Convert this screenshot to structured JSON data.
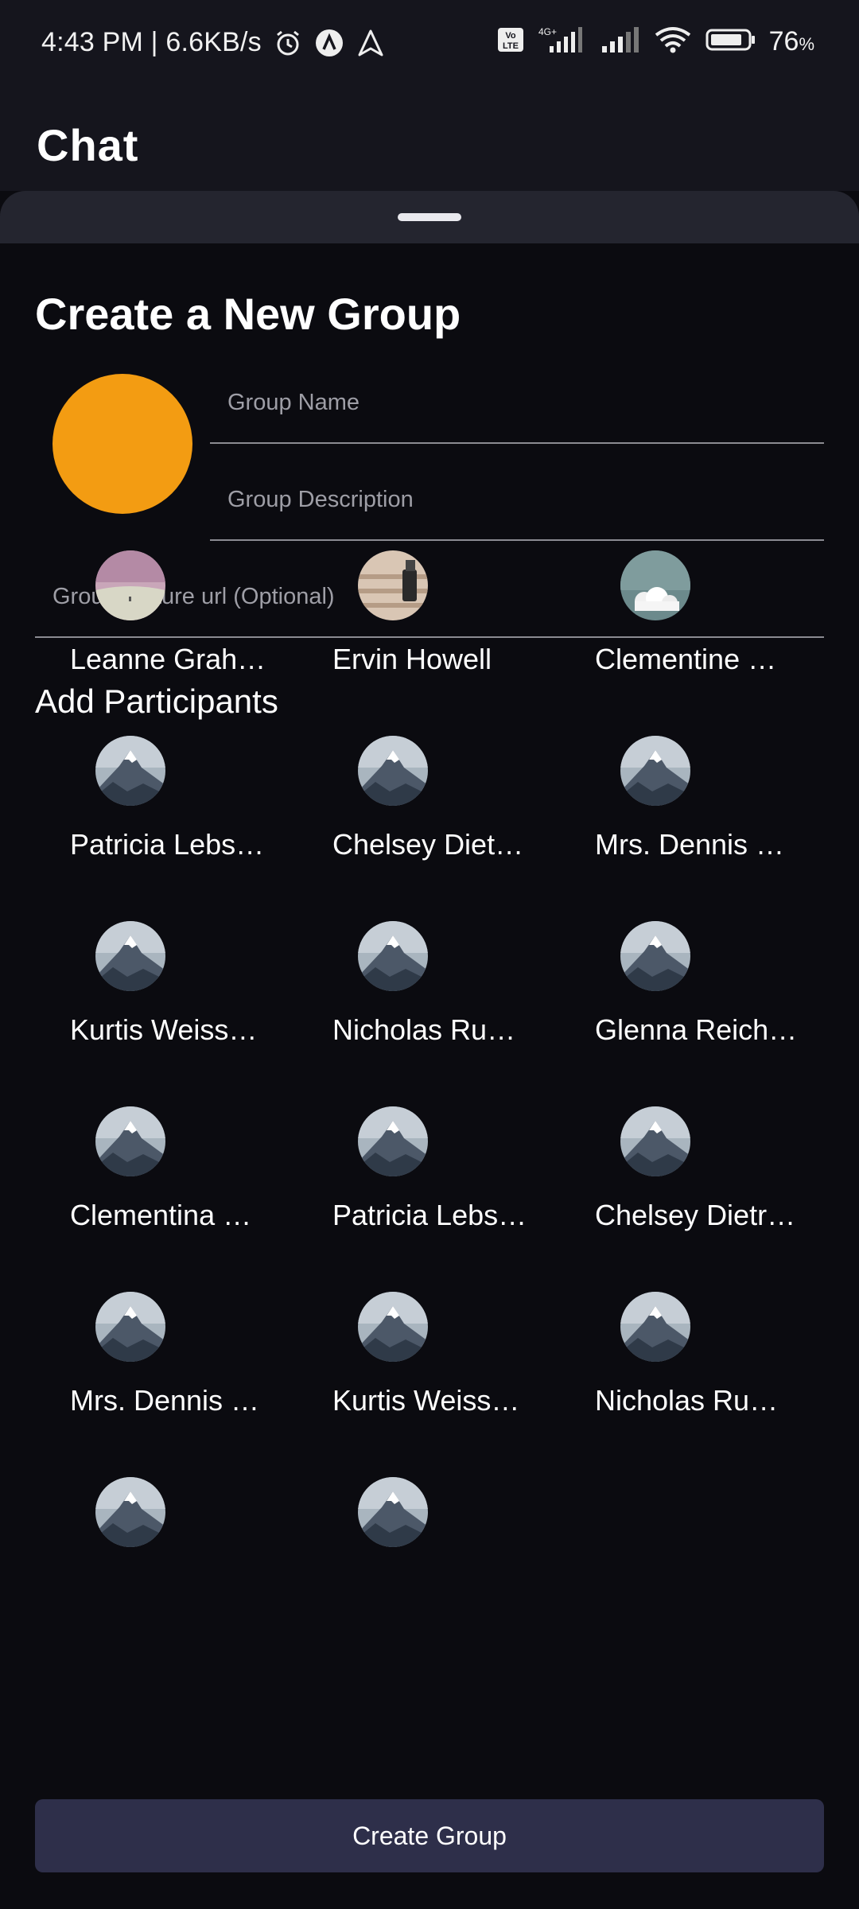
{
  "status_bar": {
    "time_speed": "4:43 PM | 6.6KB/s",
    "battery_percent": "76",
    "battery_unit": "%",
    "network": "4G+",
    "icons": [
      "alarm-icon",
      "app-a-icon",
      "navigation-icon",
      "volte-icon",
      "signal-icon",
      "signal-icon",
      "wifi-icon",
      "battery-icon"
    ]
  },
  "header": {
    "title": "Chat"
  },
  "sheet": {
    "title": "Create a New Group",
    "group_avatar_color": "#f39c12",
    "fields": {
      "name_placeholder": "Group Name",
      "description_placeholder": "Group Description",
      "picture_url_placeholder": "Group Picture url (Optional)"
    },
    "participants_title": "Add Participants",
    "participants": [
      {
        "name": "Leanne Grah…",
        "avatar": "pink-landscape"
      },
      {
        "name": "Ervin Howell",
        "avatar": "wood-interior"
      },
      {
        "name": "Clementine …",
        "avatar": "clouds-sky"
      },
      {
        "name": "Patricia Lebs…",
        "avatar": "mountain"
      },
      {
        "name": "Chelsey Diet…",
        "avatar": "mountain"
      },
      {
        "name": "Mrs. Dennis …",
        "avatar": "mountain"
      },
      {
        "name": "Kurtis Weiss…",
        "avatar": "mountain"
      },
      {
        "name": "Nicholas Ru…",
        "avatar": "mountain"
      },
      {
        "name": "Glenna Reich…",
        "avatar": "mountain"
      },
      {
        "name": "Clementina …",
        "avatar": "mountain"
      },
      {
        "name": "Patricia Lebs…",
        "avatar": "mountain"
      },
      {
        "name": "Chelsey Dietr…",
        "avatar": "mountain"
      },
      {
        "name": "Mrs. Dennis …",
        "avatar": "mountain"
      },
      {
        "name": "Kurtis Weiss…",
        "avatar": "mountain"
      },
      {
        "name": "Nicholas Ru…",
        "avatar": "mountain"
      },
      {
        "name": "",
        "avatar": "mountain"
      },
      {
        "name": "",
        "avatar": "mountain"
      }
    ],
    "create_button_label": "Create Group"
  },
  "colors": {
    "background": "#0b0b10",
    "header_bg": "#15151d",
    "sheet_handle_bg": "#24252f",
    "button_bg": "#2e2f4a",
    "accent": "#f39c12"
  }
}
